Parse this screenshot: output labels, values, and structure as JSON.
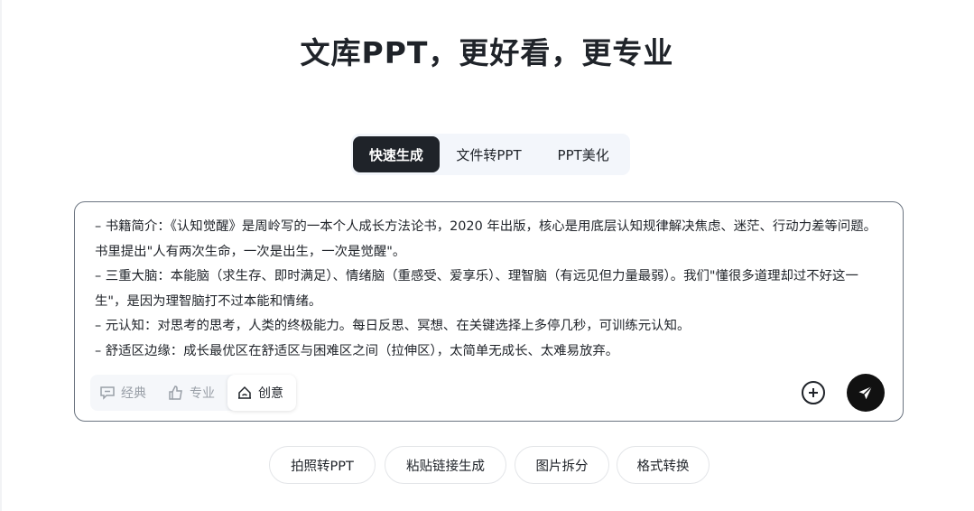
{
  "header": {
    "title": "文库PPT，更好看，更专业"
  },
  "mode_tabs": [
    {
      "label": "快速生成",
      "active": true
    },
    {
      "label": "文件转PPT",
      "active": false
    },
    {
      "label": "PPT美化",
      "active": false
    }
  ],
  "editor": {
    "text": "– 书籍简介：《认知觉醒》是周岭写的一本个人成长方法论书，2020 年出版，核心是用底层认知规律解决焦虑、迷茫、行动力差等问题。书里提出\"人有两次生命，一次是出生，一次是觉醒\"。\n– 三重大脑：本能脑（求生存、即时满足）、情绪脑（重感受、爱享乐）、理智脑（有远见但力量最弱）。我们\"懂很多道理却过不好这一生\"，是因为理智脑打不过本能和情绪。\n– 元认知：对思考的思考，人类的终极能力。每日反思、冥想、在关键选择上多停几秒，可训练元认知。\n– 舒适区边缘：成长最优区在舒适区与困难区之间（拉伸区），太简单无成长、太难易放弃。",
    "style_options": [
      {
        "label": "经典",
        "icon": "chat-bubble-icon",
        "active": false
      },
      {
        "label": "专业",
        "icon": "thumbs-up-icon",
        "active": false
      },
      {
        "label": "创意",
        "icon": "creative-icon",
        "active": true
      }
    ],
    "add_icon": "plus-circle-icon",
    "send_icon": "send-icon"
  },
  "quick_actions": [
    {
      "label": "拍照转PPT"
    },
    {
      "label": "粘贴链接生成"
    },
    {
      "label": "图片拆分"
    },
    {
      "label": "格式转换"
    }
  ],
  "colors": {
    "primary": "#1f2329",
    "send": "#111111",
    "tab_bg": "#f3f6fb",
    "muted": "#9aa0a8"
  }
}
